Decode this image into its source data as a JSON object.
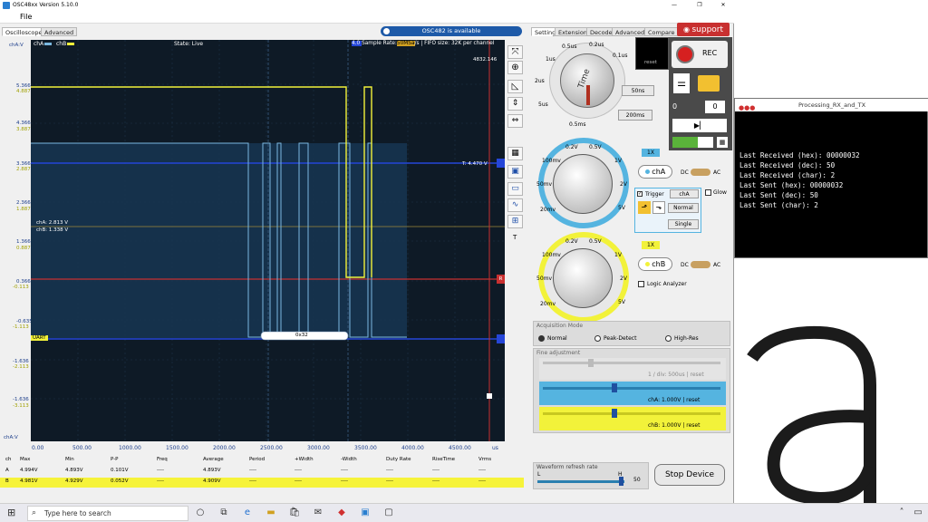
{
  "window": {
    "title": "OSC48xx  Version 5.10.0"
  },
  "menu": {
    "file": "File"
  },
  "tabs_left": [
    "Oscilloscope",
    "Advanced"
  ],
  "banner": {
    "text": "OSC482  is available"
  },
  "tabs_right": [
    "Setting",
    "Extension",
    "Decode",
    "Advanced",
    "Compare"
  ],
  "support": {
    "label": "support"
  },
  "scope": {
    "channels": {
      "a": "chA",
      "b": "chB"
    },
    "state": "State: Live",
    "sample_prefix": "4.0 ",
    "sample_rate": "Sample Rate:",
    "sample_rate_value": "50MSa",
    "sample_rate_suffix": "/s",
    "fifo": "| FIFO size: 32K per channel",
    "y_unit_label": "chA:V",
    "time_readout": "4832.146",
    "trigger_level": "T: 4.470 V",
    "cha_level": "chA: 2.813 V",
    "chb_level": "chB: 1.338 V",
    "uart_label": "UART",
    "decode_value": "0x32",
    "x_unit": "us",
    "marker_r": "R",
    "y_ticks_a": [
      "5.366",
      "4.366",
      "3.366",
      "2.366",
      "1.366",
      "0.366",
      "-0.635",
      "-1.636"
    ],
    "y_ticks_b": [
      "4.887",
      "3.887",
      "2.887",
      "1.887",
      "0.887",
      "-0.113",
      "-1.113",
      "-2.113",
      "-3.113"
    ],
    "x_ticks": [
      "0.00",
      "500.00",
      "1000.00",
      "1500.00",
      "2000.00",
      "2500.00",
      "3000.00",
      "3500.00",
      "4000.00",
      "4500.00"
    ],
    "chA_bottom_label": "chA:V"
  },
  "measurements": {
    "headers": [
      "ch",
      "Max",
      "Min",
      "P-P",
      "Freq",
      "Average",
      "Period",
      "+Width",
      "-Width",
      "Duty Rate",
      "RiseTime",
      "Vrms"
    ],
    "rows": [
      [
        "A",
        "4.994V",
        "4.893V",
        "0.101V",
        "----",
        "4.893V",
        "----",
        "----",
        "----",
        "----",
        "----",
        "----"
      ],
      [
        "B",
        "4.981V",
        "4.929V",
        "0.052V",
        "----",
        "4.909V",
        "----",
        "----",
        "----",
        "----",
        "----",
        "----"
      ]
    ]
  },
  "time_knob": {
    "title": "Time",
    "labels": [
      "1us",
      "0.5us",
      "0.2us",
      "0.1us",
      "2us",
      "50ns",
      "5us",
      "20ns",
      "0.5ms"
    ],
    "select1": "50ns",
    "select2": "200ms",
    "reset": "reset"
  },
  "rec": {
    "label": "REC",
    "counter_left": "0",
    "counter_right": "0"
  },
  "chA_panel": {
    "labels": [
      "0.2V",
      "0.5V",
      "100mv",
      "1V",
      "50mv",
      "2V",
      "20mv",
      "5V"
    ],
    "scale": "1X",
    "button": "chA",
    "dc": "DC",
    "ac": "AC",
    "trigger_label": "Trigger",
    "trigger_channel": "chA",
    "glow": "Glow",
    "normal": "Normal",
    "single": "Single"
  },
  "chB_panel": {
    "labels": [
      "0.2V",
      "0.5V",
      "100mv",
      "1V",
      "50mv",
      "2V",
      "20mv",
      "5V"
    ],
    "scale": "1X",
    "button": "chB",
    "dc": "DC",
    "ac": "AC",
    "logic_analyzer": "Logic Analyzer"
  },
  "acquisition": {
    "title": "Acquisition Mode",
    "options": [
      "Normal",
      "Peak-Detect",
      "High-Res"
    ],
    "selected": "Normal"
  },
  "fine": {
    "title": "Fine adjustment",
    "time_label": "1 / div: 500us | reset",
    "cha_label": "chA: 1.000V | reset",
    "chb_label": "chB: 1.000V | reset"
  },
  "refresh": {
    "title": "Waveform refresh rate",
    "low": "L",
    "high": "H",
    "value": "50"
  },
  "stop_button": "Stop Device",
  "processing": {
    "title": "Processing_RX_and_TX",
    "lines": [
      "Last Received (hex): 00000032",
      "Last Received (dec): 50",
      "Last Received (char): 2",
      "Last Sent (hex): 00000032",
      "Last Sent (dec): 50",
      "Last Sent (char): 2"
    ]
  },
  "taskbar": {
    "search_placeholder": "Type here to search"
  },
  "colors": {
    "chA": "#f2f23a",
    "chB": "#55a8d8",
    "trigger": "#1f3fd8",
    "marker": "#d02020",
    "scope_bg": "#0e1a26"
  }
}
